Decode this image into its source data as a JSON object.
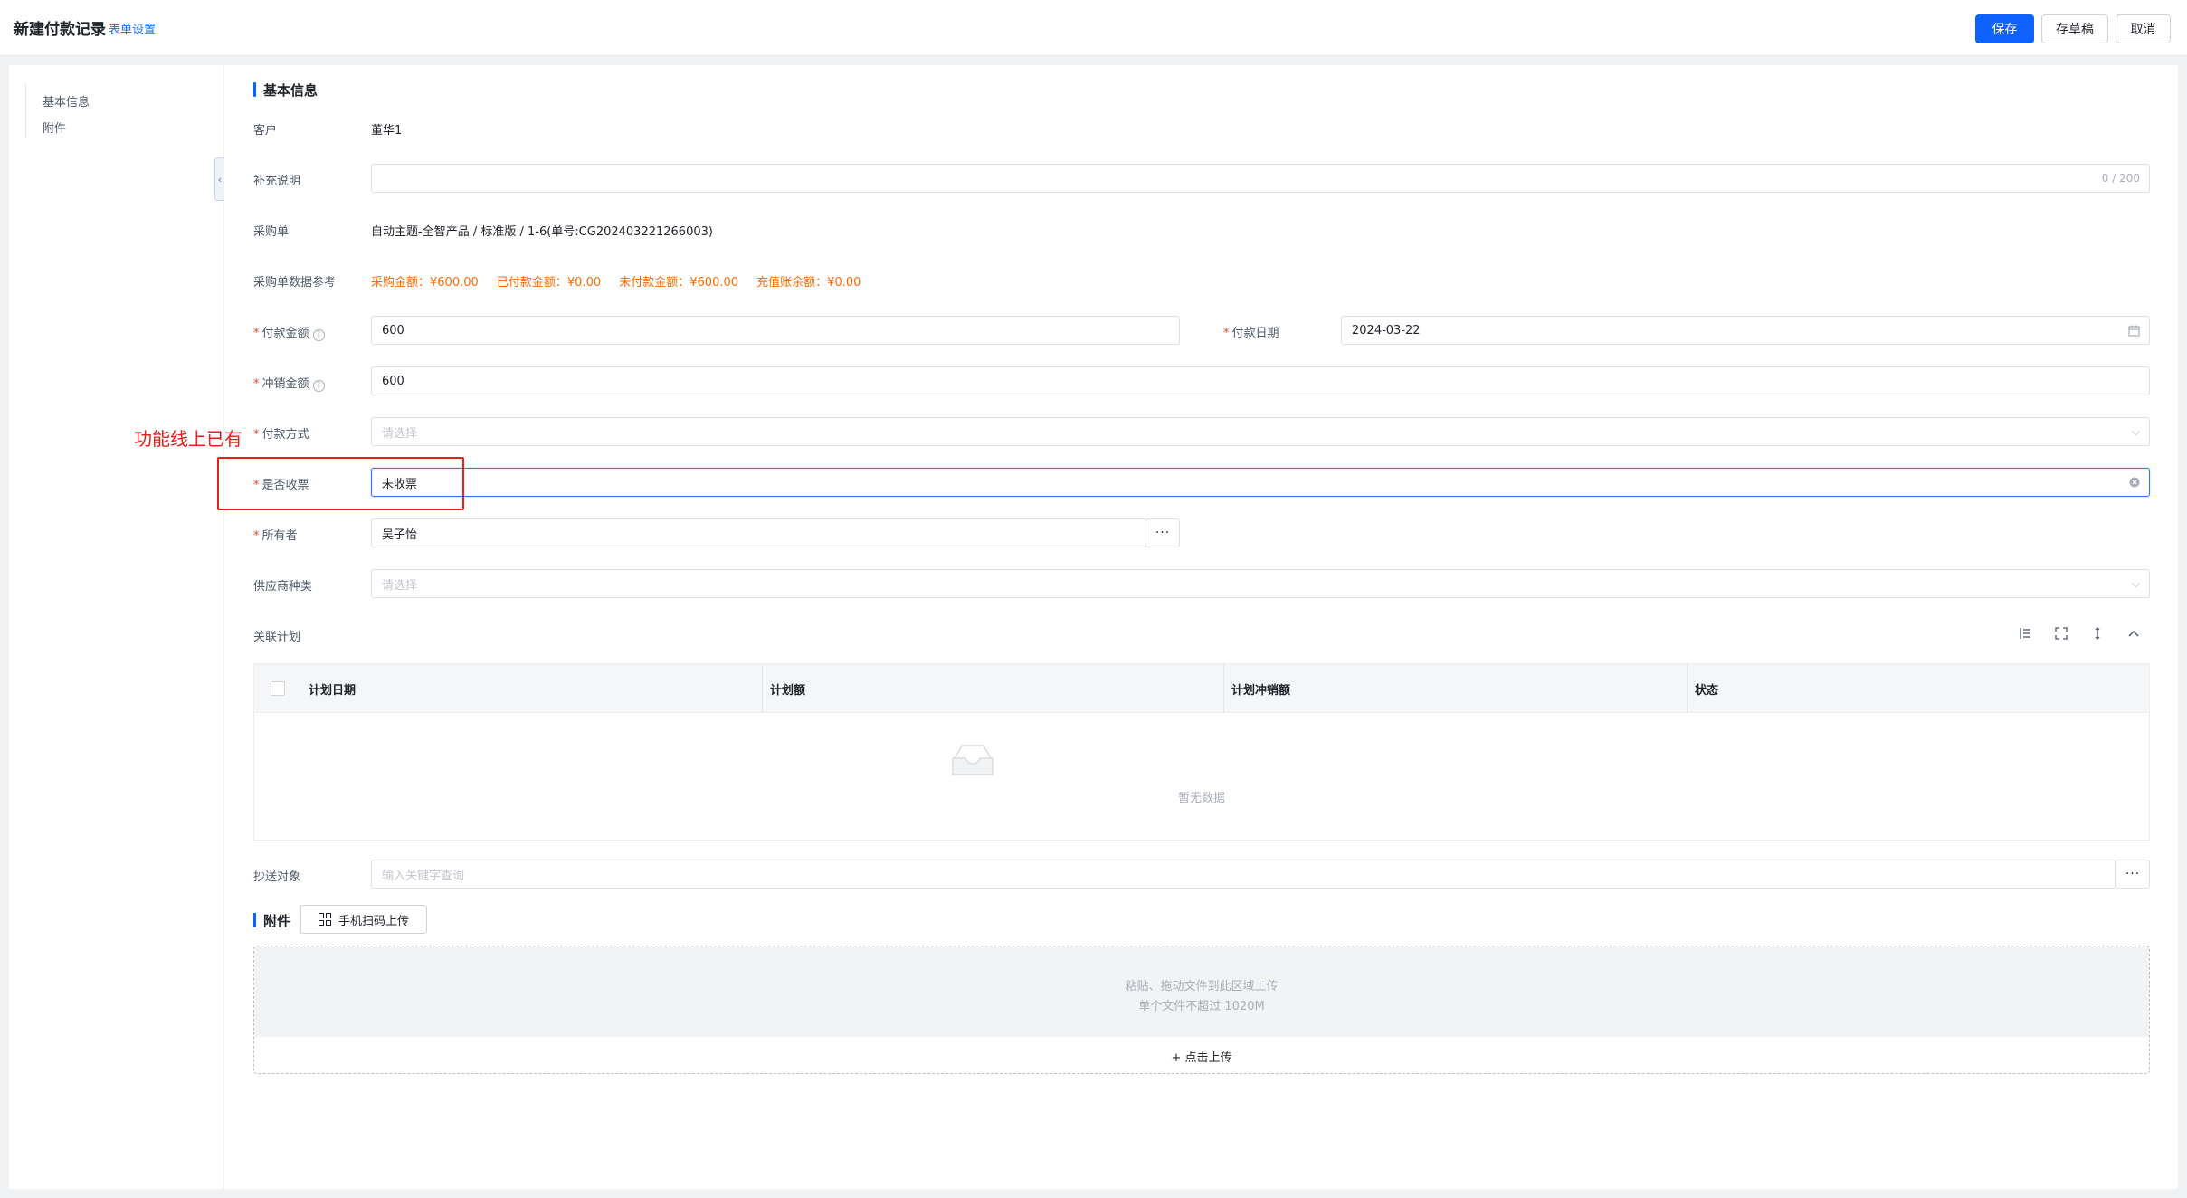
{
  "header": {
    "title": "新建付款记录",
    "form_settings": "表单设置",
    "save": "保存",
    "draft": "存草稿",
    "cancel": "取消"
  },
  "sidebar": {
    "items": [
      {
        "label": "基本信息"
      },
      {
        "label": "附件"
      }
    ]
  },
  "section": {
    "basic_info": "基本信息",
    "attachments": "附件"
  },
  "fields": {
    "customer": {
      "label": "客户",
      "value": "董华1"
    },
    "remarks": {
      "label": "补充说明",
      "value": "",
      "counter": "0 / 200"
    },
    "purchase_order": {
      "label": "采购单",
      "value": "自动主题-全智产品 / 标准版 / 1-6(单号:CG202403221266003)"
    },
    "po_reference": {
      "label": "采购单数据参考",
      "purchase_amount": "采购金额：¥600.00",
      "paid_amount": "已付款金额：¥0.00",
      "unpaid_amount": "未付款金额：¥600.00",
      "prepaid_balance": "充值账余额：¥0.00"
    },
    "payment_amount": {
      "label": "付款金额",
      "value": "600",
      "required": "*"
    },
    "payment_date": {
      "label": "付款日期",
      "value": "2024-03-22",
      "required": "*"
    },
    "writeoff_amount": {
      "label": "冲销金额",
      "value": "600",
      "required": "*"
    },
    "payment_method": {
      "label": "付款方式",
      "placeholder": "请选择",
      "required": "*"
    },
    "invoice_received": {
      "label": "是否收票",
      "value": "未收票",
      "required": "*"
    },
    "owner": {
      "label": "所有者",
      "value": "吴子怡",
      "required": "*",
      "more": "···"
    },
    "supplier_category": {
      "label": "供应商种类",
      "placeholder": "请选择"
    },
    "related_plan": {
      "label": "关联计划"
    },
    "cc": {
      "label": "抄送对象",
      "placeholder": "输入关键字查询",
      "more": "···"
    }
  },
  "annotation": "功能线上已有",
  "plan_table": {
    "columns": [
      "计划日期",
      "计划额",
      "计划冲销额",
      "状态"
    ],
    "empty_text": "暂无数据"
  },
  "attachments": {
    "scan_button": "手机扫码上传",
    "drop_hint": "粘贴、拖动文件到此区域上传",
    "size_hint": "单个文件不超过 1020M",
    "upload": "+ 点击上传"
  },
  "colors": {
    "primary": "#0f62fe",
    "warning_text": "#ff6a00",
    "annotation": "#e3201b"
  }
}
